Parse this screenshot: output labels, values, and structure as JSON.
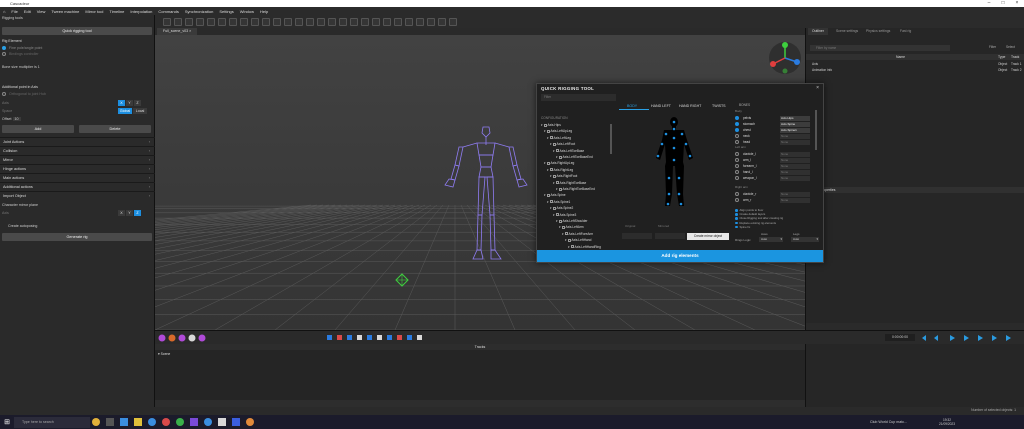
{
  "window": {
    "title": "Cascadeur"
  },
  "menu": [
    "File",
    "Edit",
    "View",
    "Tween machine",
    "Mirror tool",
    "Timeline",
    "Interpolation",
    "Commands",
    "Synchronization",
    "Settings",
    "Window",
    "Help"
  ],
  "left_panel": {
    "title": "Rigging tools",
    "quick_rigging_button": "Quick rigging tool",
    "rig_element": "Rig Element",
    "mode_options": [
      "Fine pole/angle point",
      "Bindings controller"
    ],
    "bone_size_label": "Bone size multiplier is",
    "bone_size_value": "1",
    "additional_points": "Additional point in Axis",
    "orthogonal_label": "Orthogonal to joint Hub",
    "axis_label": "Axis",
    "axis_options": [
      "X",
      "Y",
      "Z"
    ],
    "space_label": "Space",
    "space_options": [
      "Global",
      "Local"
    ],
    "offset_label": "Offset",
    "offset_value": "10",
    "add_button": "Add",
    "delete_button": "Delete",
    "sections": [
      "Joint Actions",
      "Collision",
      "Mirror",
      "Hinge actions",
      "Main actions",
      "Additional actions",
      "Import Object"
    ],
    "character_mirror_plane": "Character mirror plane",
    "mirror_axis": "Axis",
    "create_autoposing": "Create autoposing",
    "generate_rig": "Generate rig"
  },
  "viewport": {
    "tab": "Full_scene_v03"
  },
  "right_panel": {
    "tabs": [
      "Outliner",
      "Scene settings",
      "Physics settings",
      "Fast rig"
    ],
    "filter_placeholder": "Filter by name",
    "filter_buttons": [
      "Filter",
      "Select"
    ],
    "columns": [
      "Name",
      "Type",
      "Track"
    ],
    "rows": [
      {
        "name": "Axis",
        "type": "Object",
        "track": "Track 1"
      },
      {
        "name": "Animation info",
        "type": "Object",
        "track": "Track 2"
      }
    ],
    "properties_title": "Properties"
  },
  "transport": {
    "time": "0:00:00:00"
  },
  "timeline": {
    "title": "Tracks",
    "scene_label": "Scene"
  },
  "status": {
    "right": "Number of selected objects: 1"
  },
  "taskbar": {
    "search": "Type here to search",
    "notification": "Club World Cup matc...",
    "time": "19:32",
    "date": "21/09/2023"
  },
  "dialog": {
    "title": "QUICK RIGGING TOOL",
    "filter_placeholder": "Filter",
    "config_label": "CONFIGURATION",
    "tree": [
      {
        "label": "Axis.Hips",
        "depth": 0
      },
      {
        "label": "Axis.LeftUpLeg",
        "depth": 1
      },
      {
        "label": "Axis.LeftLeg",
        "depth": 2
      },
      {
        "label": "Axis.LeftFoot",
        "depth": 3
      },
      {
        "label": "Axis.LeftToeBase",
        "depth": 4
      },
      {
        "label": "Axis.LeftToeBaseEnd",
        "depth": 5
      },
      {
        "label": "Axis.RightUpLeg",
        "depth": 1
      },
      {
        "label": "Axis.RightLeg",
        "depth": 2
      },
      {
        "label": "Axis.RightFoot",
        "depth": 3
      },
      {
        "label": "Axis.RightToeBase",
        "depth": 4
      },
      {
        "label": "Axis.RightToeBaseEnd",
        "depth": 5
      },
      {
        "label": "Axis.Spine",
        "depth": 1
      },
      {
        "label": "Axis.Spine1",
        "depth": 2
      },
      {
        "label": "Axis.Spine2",
        "depth": 3
      },
      {
        "label": "Axis.Spine3",
        "depth": 4
      },
      {
        "label": "Axis.LeftShoulder",
        "depth": 5
      },
      {
        "label": "Axis.LeftArm",
        "depth": 6
      },
      {
        "label": "Axis.LeftForeArm",
        "depth": 7
      },
      {
        "label": "Axis.LeftHand",
        "depth": 8
      },
      {
        "label": "Axis.LeftHandRing",
        "depth": 9
      }
    ],
    "tabs": [
      "BODY",
      "HAND LEFT",
      "HAND RIGHT",
      "TWISTS"
    ],
    "bones_header": "BONES",
    "groups": [
      "Body",
      "Left arm",
      "Right arm"
    ],
    "bones": [
      {
        "name": "pelvis",
        "value": "Axis.Hips",
        "set": true
      },
      {
        "name": "stomach",
        "value": "Axis.Spine",
        "set": true
      },
      {
        "name": "chest",
        "value": "Axis.Spine1",
        "set": true
      },
      {
        "name": "neck",
        "value": "None",
        "set": false
      },
      {
        "name": "head",
        "value": "None",
        "set": false
      },
      {
        "name": "clavicle_l",
        "value": "None",
        "set": false
      },
      {
        "name": "arm_l",
        "value": "None",
        "set": false
      },
      {
        "name": "forearm_l",
        "value": "None",
        "set": false
      },
      {
        "name": "hand_l",
        "value": "None",
        "set": false
      },
      {
        "name": "weapon_l",
        "value": "None",
        "set": false
      },
      {
        "name": "clavicle_r",
        "value": "None",
        "set": false
      },
      {
        "name": "arm_r",
        "value": "None",
        "set": false
      }
    ],
    "original_label": "Original",
    "mirrored_label": "Mirrored",
    "mirror_button": "Create mirror object",
    "checkbox_options": [
      "Align points to floor",
      "Create default layers",
      "Close Rigging tool after creating rig",
      "Replace existing rig elements",
      "Spine fix"
    ],
    "axes_label": "Axes",
    "legs_label": "Legs",
    "rings_label": "Rings Logic",
    "axes_value": "Auto",
    "legs_value": "Auto",
    "add_rig_button": "Add rig elements"
  }
}
